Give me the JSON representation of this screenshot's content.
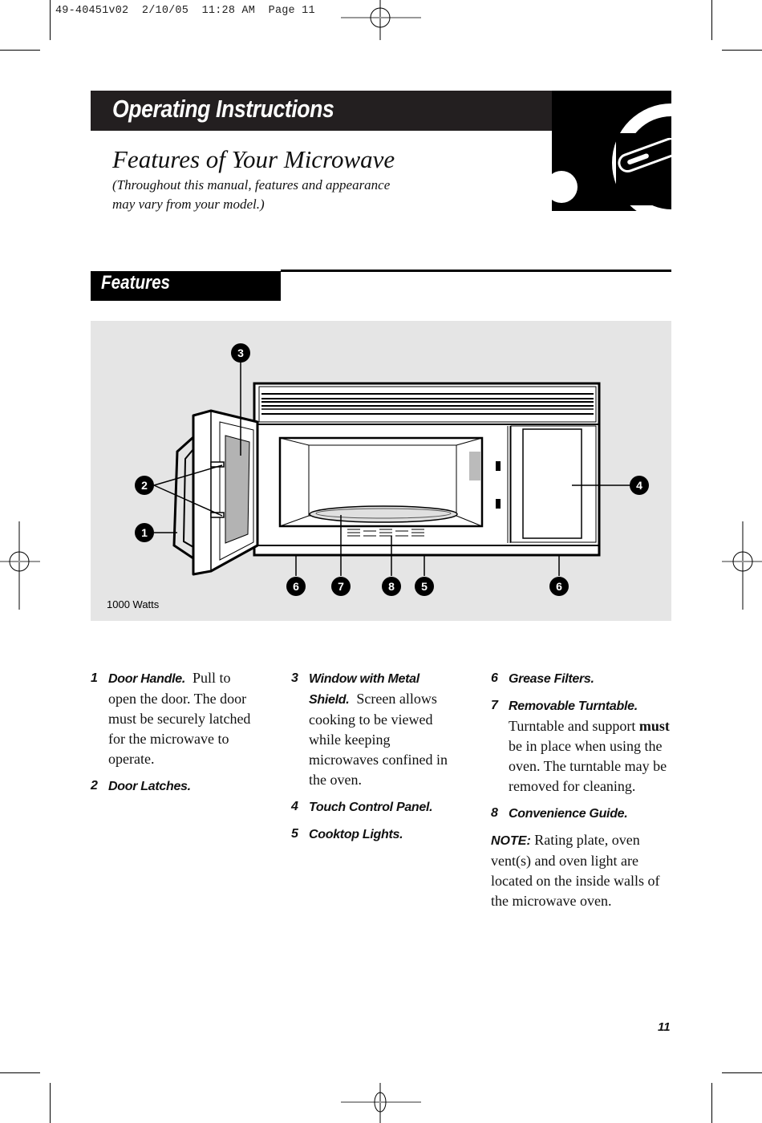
{
  "print_slug": "49-40451v02  2/10/05  11:28 AM  Page 11",
  "header": {
    "section_title": "Operating Instructions",
    "page_title": "Features of Your Microwave",
    "subtitle_line1": "(Throughout this manual, features and appearance",
    "subtitle_line2": "may vary from your model.)"
  },
  "features_heading": "Features",
  "diagram": {
    "wattage_label": "1000 Watts",
    "callouts": [
      "1",
      "2",
      "3",
      "4",
      "5",
      "6",
      "7",
      "8"
    ]
  },
  "features": [
    {
      "num": "1",
      "label": "Door Handle.",
      "desc": "Pull to open the door. The door must be securely latched for the microwave to operate."
    },
    {
      "num": "2",
      "label": "Door Latches.",
      "desc": ""
    },
    {
      "num": "3",
      "label": "Window with Metal Shield.",
      "desc": "Screen allows cooking to be viewed while keeping microwaves confined in the oven."
    },
    {
      "num": "4",
      "label": "Touch Control Panel.",
      "desc": ""
    },
    {
      "num": "5",
      "label": "Cooktop Lights.",
      "desc": ""
    },
    {
      "num": "6",
      "label": "Grease Filters.",
      "desc": ""
    },
    {
      "num": "7",
      "label": "Removable Turntable.",
      "desc_pre": "Turntable and support ",
      "desc_bold": "must",
      "desc_post": " be in place when using the oven. The turntable may be removed for cleaning."
    },
    {
      "num": "8",
      "label": "Convenience Guide.",
      "desc": ""
    }
  ],
  "note": {
    "label": "NOTE:",
    "text": "Rating plate, oven vent(s) and oven light are located on the inside walls of the microwave oven."
  },
  "page_number": "11"
}
